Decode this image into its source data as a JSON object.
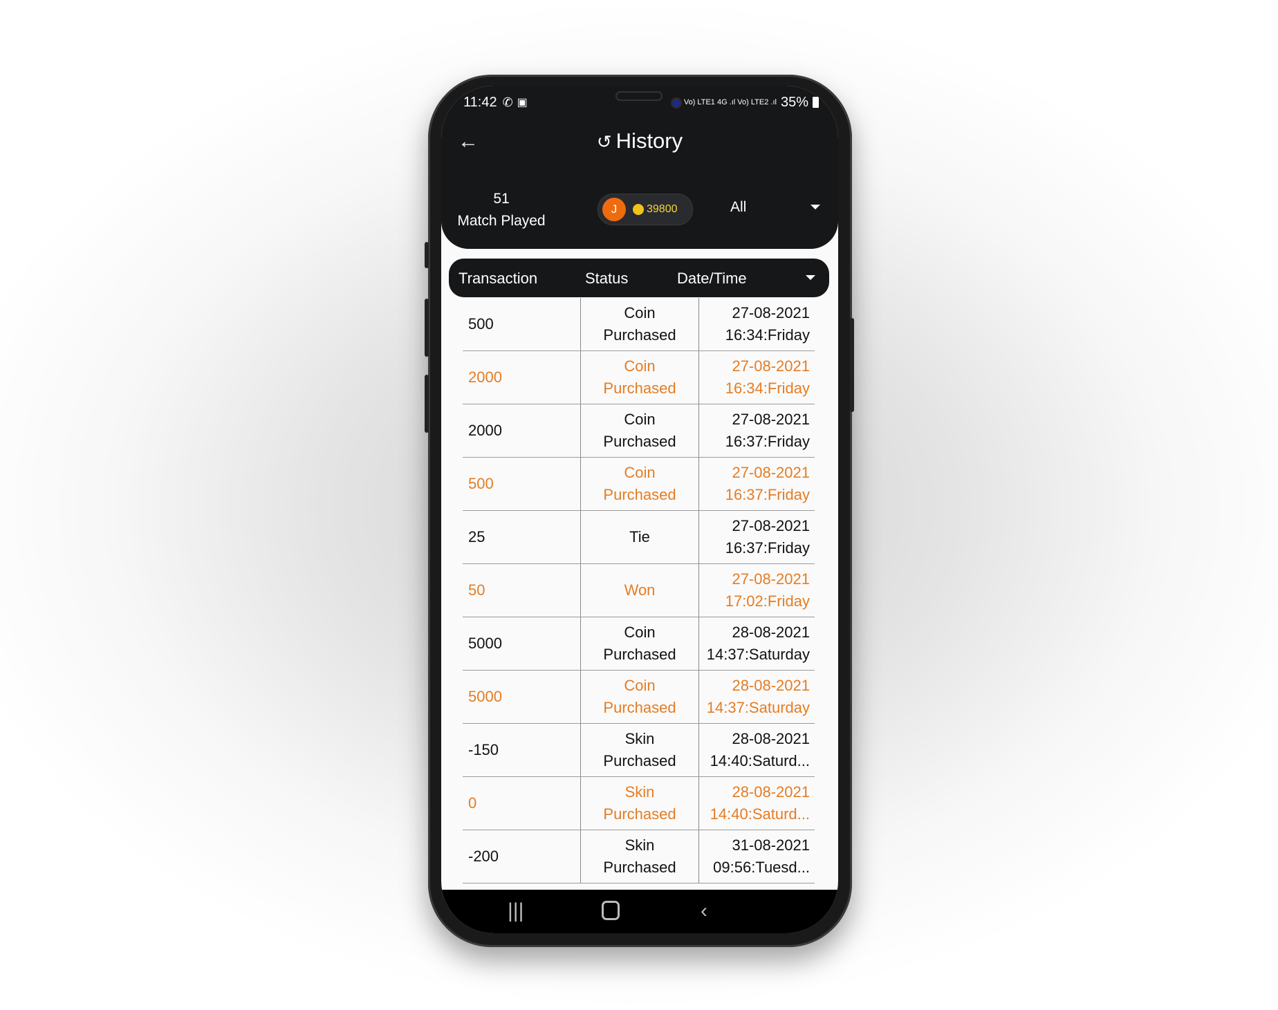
{
  "status_bar": {
    "time": "11:42",
    "indicators": "Vo) LTE1 4G .ıl Vo) LTE2 .ıl",
    "battery": "35%"
  },
  "header": {
    "title": "History",
    "back_icon": "arrow-left-icon",
    "title_icon": "history-icon"
  },
  "stats": {
    "matches_count": "51",
    "matches_label": "Match Played",
    "avatar_letter": "J",
    "coins": "39800",
    "filter_value": "All"
  },
  "colors": {
    "accent": "#e57c22",
    "dark": "#161719",
    "coin_text": "#f5d63a",
    "avatar": "#ee6c0f"
  },
  "table": {
    "headers": [
      "Transaction",
      "Status",
      "Date/Time"
    ],
    "rows": [
      {
        "amount": "500",
        "status1": "Coin",
        "status2": "Purchased",
        "date": "27-08-2021",
        "time": "16:34:Friday",
        "highlight": false
      },
      {
        "amount": "2000",
        "status1": "Coin",
        "status2": "Purchased",
        "date": "27-08-2021",
        "time": "16:34:Friday",
        "highlight": true
      },
      {
        "amount": "2000",
        "status1": "Coin",
        "status2": "Purchased",
        "date": "27-08-2021",
        "time": "16:37:Friday",
        "highlight": false
      },
      {
        "amount": "500",
        "status1": "Coin",
        "status2": "Purchased",
        "date": "27-08-2021",
        "time": "16:37:Friday",
        "highlight": true
      },
      {
        "amount": "25",
        "status1": "Tie",
        "status2": "",
        "date": "27-08-2021",
        "time": "16:37:Friday",
        "highlight": false
      },
      {
        "amount": "50",
        "status1": "Won",
        "status2": "",
        "date": "27-08-2021",
        "time": "17:02:Friday",
        "highlight": true
      },
      {
        "amount": "5000",
        "status1": "Coin",
        "status2": "Purchased",
        "date": "28-08-2021",
        "time": "14:37:Saturday",
        "highlight": false
      },
      {
        "amount": "5000",
        "status1": "Coin",
        "status2": "Purchased",
        "date": "28-08-2021",
        "time": "14:37:Saturday",
        "highlight": true
      },
      {
        "amount": "-150",
        "status1": "Skin",
        "status2": "Purchased",
        "date": "28-08-2021",
        "time": "14:40:Saturd...",
        "highlight": false
      },
      {
        "amount": "0",
        "status1": "Skin",
        "status2": "Purchased",
        "date": "28-08-2021",
        "time": "14:40:Saturd...",
        "highlight": true
      },
      {
        "amount": "-200",
        "status1": "Skin",
        "status2": "Purchased",
        "date": "31-08-2021",
        "time": "09:56:Tuesd...",
        "highlight": false
      }
    ]
  }
}
